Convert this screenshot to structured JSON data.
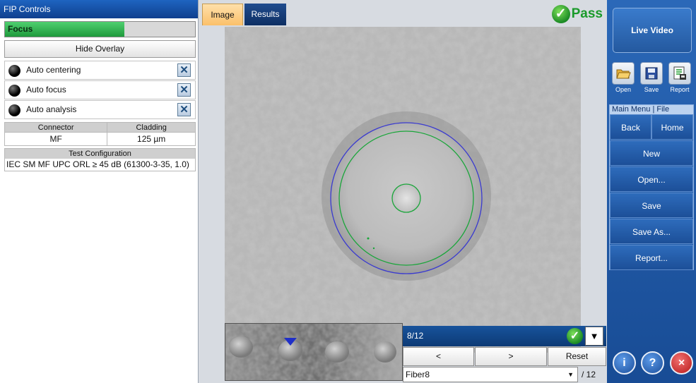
{
  "left_panel": {
    "title": "FIP Controls",
    "focus": {
      "label": "Focus",
      "level_percent": 63
    },
    "hide_overlay_label": "Hide Overlay",
    "options": [
      {
        "label": "Auto centering"
      },
      {
        "label": "Auto focus"
      },
      {
        "label": "Auto analysis"
      }
    ],
    "specs": {
      "connector_header": "Connector",
      "cladding_header": "Cladding",
      "connector_value": "MF",
      "cladding_value": "125 µm"
    },
    "test_config": {
      "header": "Test Configuration",
      "value": "IEC SM MF UPC ORL ≥ 45 dB (61300-3-35, 1.0)"
    }
  },
  "center": {
    "tabs": [
      {
        "label": "Image"
      },
      {
        "label": "Results"
      }
    ],
    "status": {
      "label": "Pass",
      "check_glyph": "✓"
    },
    "navigator": {
      "count": "8/12",
      "check_glyph": "✓",
      "dropdown_glyph": "▼",
      "prev_label": "<",
      "next_label": ">",
      "reset_label": "Reset",
      "fiber_selected": "Fiber8",
      "select_arrow": "▼",
      "fiber_total": "/ 12"
    }
  },
  "right_panel": {
    "live_video_label": "Live Video",
    "file_buttons": [
      {
        "label": "Open",
        "icon": "open-folder-icon"
      },
      {
        "label": "Save",
        "icon": "floppy-disk-icon"
      },
      {
        "label": "Report",
        "icon": "report-icon"
      }
    ],
    "menu": {
      "header": "Main Menu | File",
      "back_label": "Back",
      "home_label": "Home",
      "items": [
        "New",
        "Open...",
        "Save",
        "Save As...",
        "Report..."
      ]
    },
    "bottom_buttons": [
      {
        "glyph": "i",
        "icon": "info-icon"
      },
      {
        "glyph": "?",
        "icon": "help-icon"
      },
      {
        "glyph": "×",
        "icon": "close-icon"
      }
    ]
  },
  "colors": {
    "pass_green": "#1a9a2a",
    "panel_blue": "#184c95",
    "title_blue": "#0f3f8e",
    "overlay_blue_ring": "#2a2ad0",
    "overlay_green_ring": "#1aa63a"
  }
}
